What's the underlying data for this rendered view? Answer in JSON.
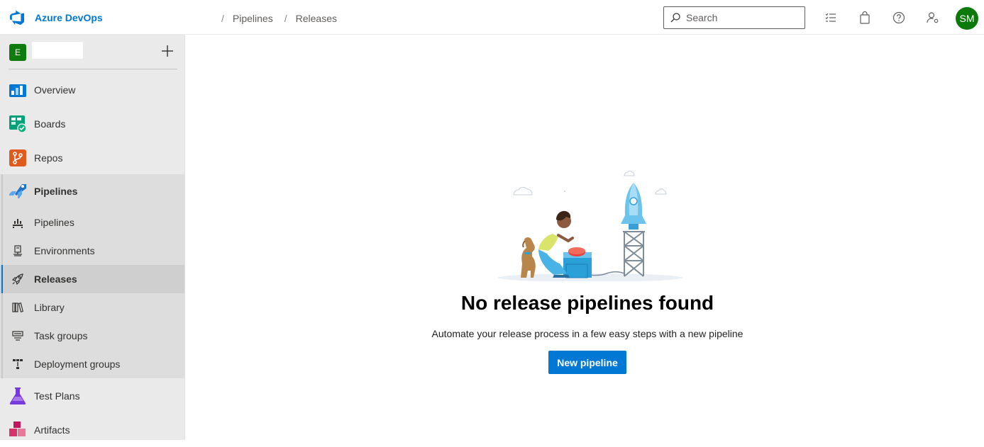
{
  "header": {
    "brand": "Azure DevOps",
    "breadcrumbs": [
      {
        "sep": "/",
        "label": "Pipelines"
      },
      {
        "sep": "/",
        "label": "Releases"
      }
    ],
    "search_placeholder": "Search",
    "icons": [
      "work-items-icon",
      "marketplace-bag-icon",
      "help-icon",
      "user-settings-icon"
    ],
    "avatar_initials": "SM",
    "accent": "#0078d4"
  },
  "sidebar": {
    "project_badge": "E",
    "add_icon": "plus-icon",
    "items": [
      {
        "label": "Overview",
        "icon": "overview-icon"
      },
      {
        "label": "Boards",
        "icon": "boards-icon"
      },
      {
        "label": "Repos",
        "icon": "repos-icon"
      },
      {
        "label": "Pipelines",
        "icon": "pipelines-icon"
      },
      {
        "label": "Test Plans",
        "icon": "test-plans-icon"
      },
      {
        "label": "Artifacts",
        "icon": "artifacts-icon"
      }
    ],
    "sub_items": [
      {
        "label": "Pipelines",
        "icon": "pipelines-sub-icon"
      },
      {
        "label": "Environments",
        "icon": "environments-icon"
      },
      {
        "label": "Releases",
        "icon": "rocket-icon",
        "selected": true
      },
      {
        "label": "Library",
        "icon": "library-icon"
      },
      {
        "label": "Task groups",
        "icon": "task-groups-icon"
      },
      {
        "label": "Deployment groups",
        "icon": "deployment-groups-icon"
      }
    ]
  },
  "main": {
    "empty_title": "No release pipelines found",
    "empty_description": "Automate your release process in a few easy steps with a new pipeline",
    "primary_button": "New pipeline"
  }
}
